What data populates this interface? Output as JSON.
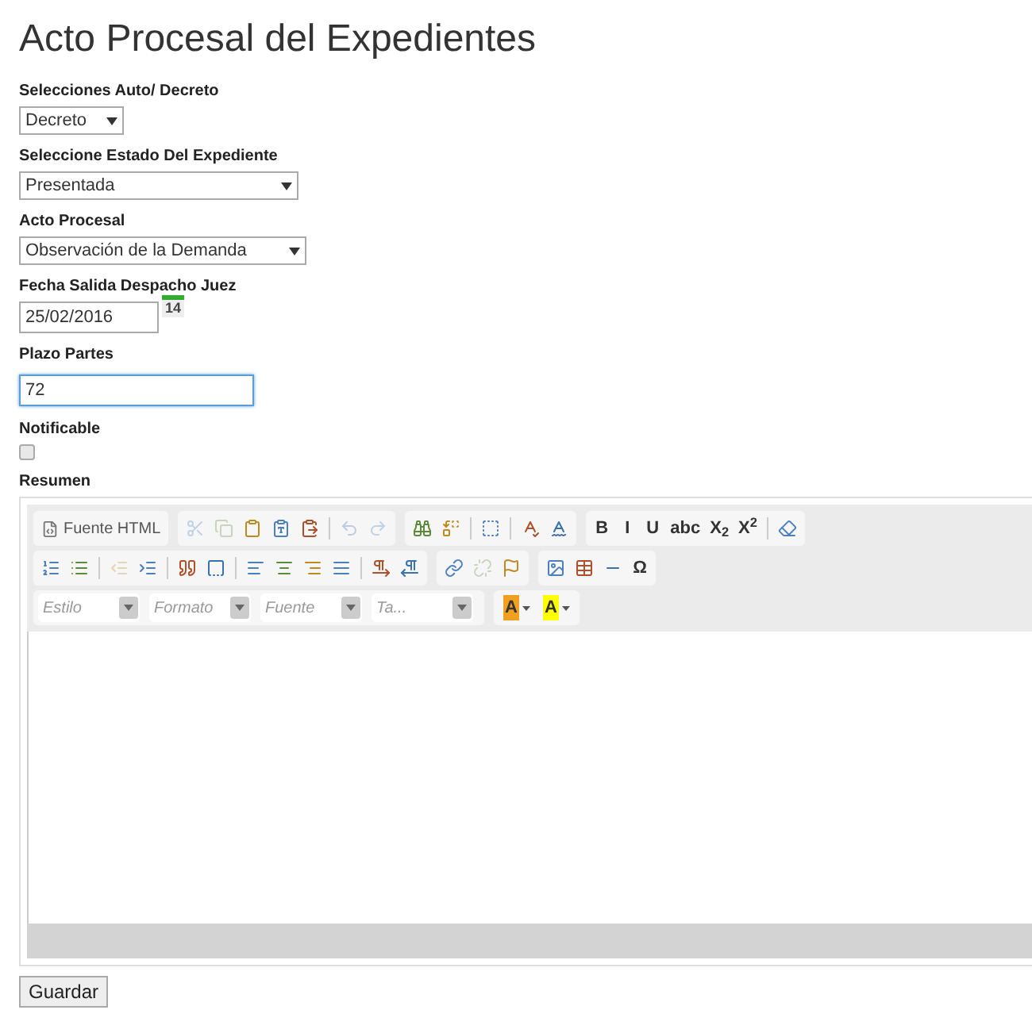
{
  "title": "Acto Procesal del Expedientes",
  "fields": [
    {
      "kind": "select",
      "label": "Selecciones Auto/ Decreto",
      "value": "Decreto"
    },
    {
      "kind": "select",
      "label": "Seleccione Estado Del Expediente",
      "value": "Presentada"
    },
    {
      "kind": "select",
      "label": "Acto Procesal",
      "value": "Observación de la Demanda"
    },
    {
      "kind": "date",
      "label": "Fecha Salida Despacho Juez",
      "value": "25/02/2016",
      "calendar_day": "14"
    },
    {
      "kind": "text",
      "label": "Plazo Partes",
      "value": "72",
      "focused": true
    },
    {
      "kind": "checkbox",
      "label": "Notificable",
      "checked": false
    }
  ],
  "editor": {
    "label": "Resumen",
    "rows": [
      [
        [
          {
            "kind": "button",
            "label": "Fuente HTML"
          }
        ],
        [
          {
            "kind": "icon",
            "disabled": true
          },
          {
            "kind": "icon",
            "disabled": true
          },
          {
            "kind": "icon",
            "disabled": false
          },
          {
            "kind": "icon",
            "disabled": false
          },
          {
            "kind": "icon",
            "disabled": false
          },
          {
            "kind": "separator"
          },
          {
            "kind": "icon",
            "disabled": true
          },
          {
            "kind": "icon",
            "disabled": true
          }
        ],
        [
          {
            "kind": "icon",
            "disabled": false
          },
          {
            "kind": "icon",
            "disabled": false
          },
          {
            "kind": "separator"
          },
          {
            "kind": "icon",
            "disabled": false
          },
          {
            "kind": "separator"
          },
          {
            "kind": "icon",
            "disabled": false
          },
          {
            "kind": "icon",
            "disabled": false
          }
        ],
        [
          {
            "kind": "text",
            "label": "B"
          },
          {
            "kind": "text",
            "label": "I"
          },
          {
            "kind": "text",
            "label": "U"
          },
          {
            "kind": "text",
            "label": "abc"
          },
          {
            "kind": "text",
            "label": "X$_{2}$"
          },
          {
            "kind": "text",
            "label": "X$^{2}$"
          },
          {
            "kind": "separator"
          },
          {
            "kind": "icon",
            "disabled": false
          }
        ]
      ],
      [
        [
          {
            "kind": "icon",
            "disabled": false
          },
          {
            "kind": "icon",
            "disabled": false
          },
          {
            "kind": "separator"
          },
          {
            "kind": "icon",
            "disabled": true
          },
          {
            "kind": "icon",
            "disabled": false
          },
          {
            "kind": "separator"
          },
          {
            "kind": "icon",
            "disabled": false
          },
          {
            "kind": "icon",
            "disabled": false
          },
          {
            "kind": "separator"
          },
          {
            "kind": "icon",
            "disabled": false
          },
          {
            "kind": "icon",
            "disabled": false
          },
          {
            "kind": "icon",
            "disabled": false
          },
          {
            "kind": "icon",
            "disabled": false
          },
          {
            "kind": "separator"
          },
          {
            "kind": "icon",
            "disabled": false
          },
          {
            "kind": "icon",
            "disabled": false
          }
        ],
        [
          {
            "kind": "icon",
            "disabled": false
          },
          {
            "kind": "icon",
            "disabled": true
          },
          {
            "kind": "icon",
            "disabled": false
          }
        ],
        [
          {
            "kind": "icon",
            "disabled": false
          },
          {
            "kind": "icon",
            "disabled": false
          },
          {
            "kind": "icon",
            "disabled": false
          },
          {
            "kind": "text",
            "label": "Ω"
          }
        ]
      ],
      [
        [
          {
            "kind": "combo",
            "placeholder": "Estilo"
          },
          {
            "kind": "combo",
            "placeholder": "Formato"
          },
          {
            "kind": "combo",
            "placeholder": "Fuente"
          },
          {
            "kind": "combo",
            "placeholder": "Ta..."
          }
        ],
        [
          {
            "kind": "color",
            "label": "A",
            "color": "#f0a020"
          },
          {
            "kind": "color",
            "label": "A",
            "color": "#ffff00"
          }
        ]
      ]
    ]
  },
  "save_button": "Guardar"
}
